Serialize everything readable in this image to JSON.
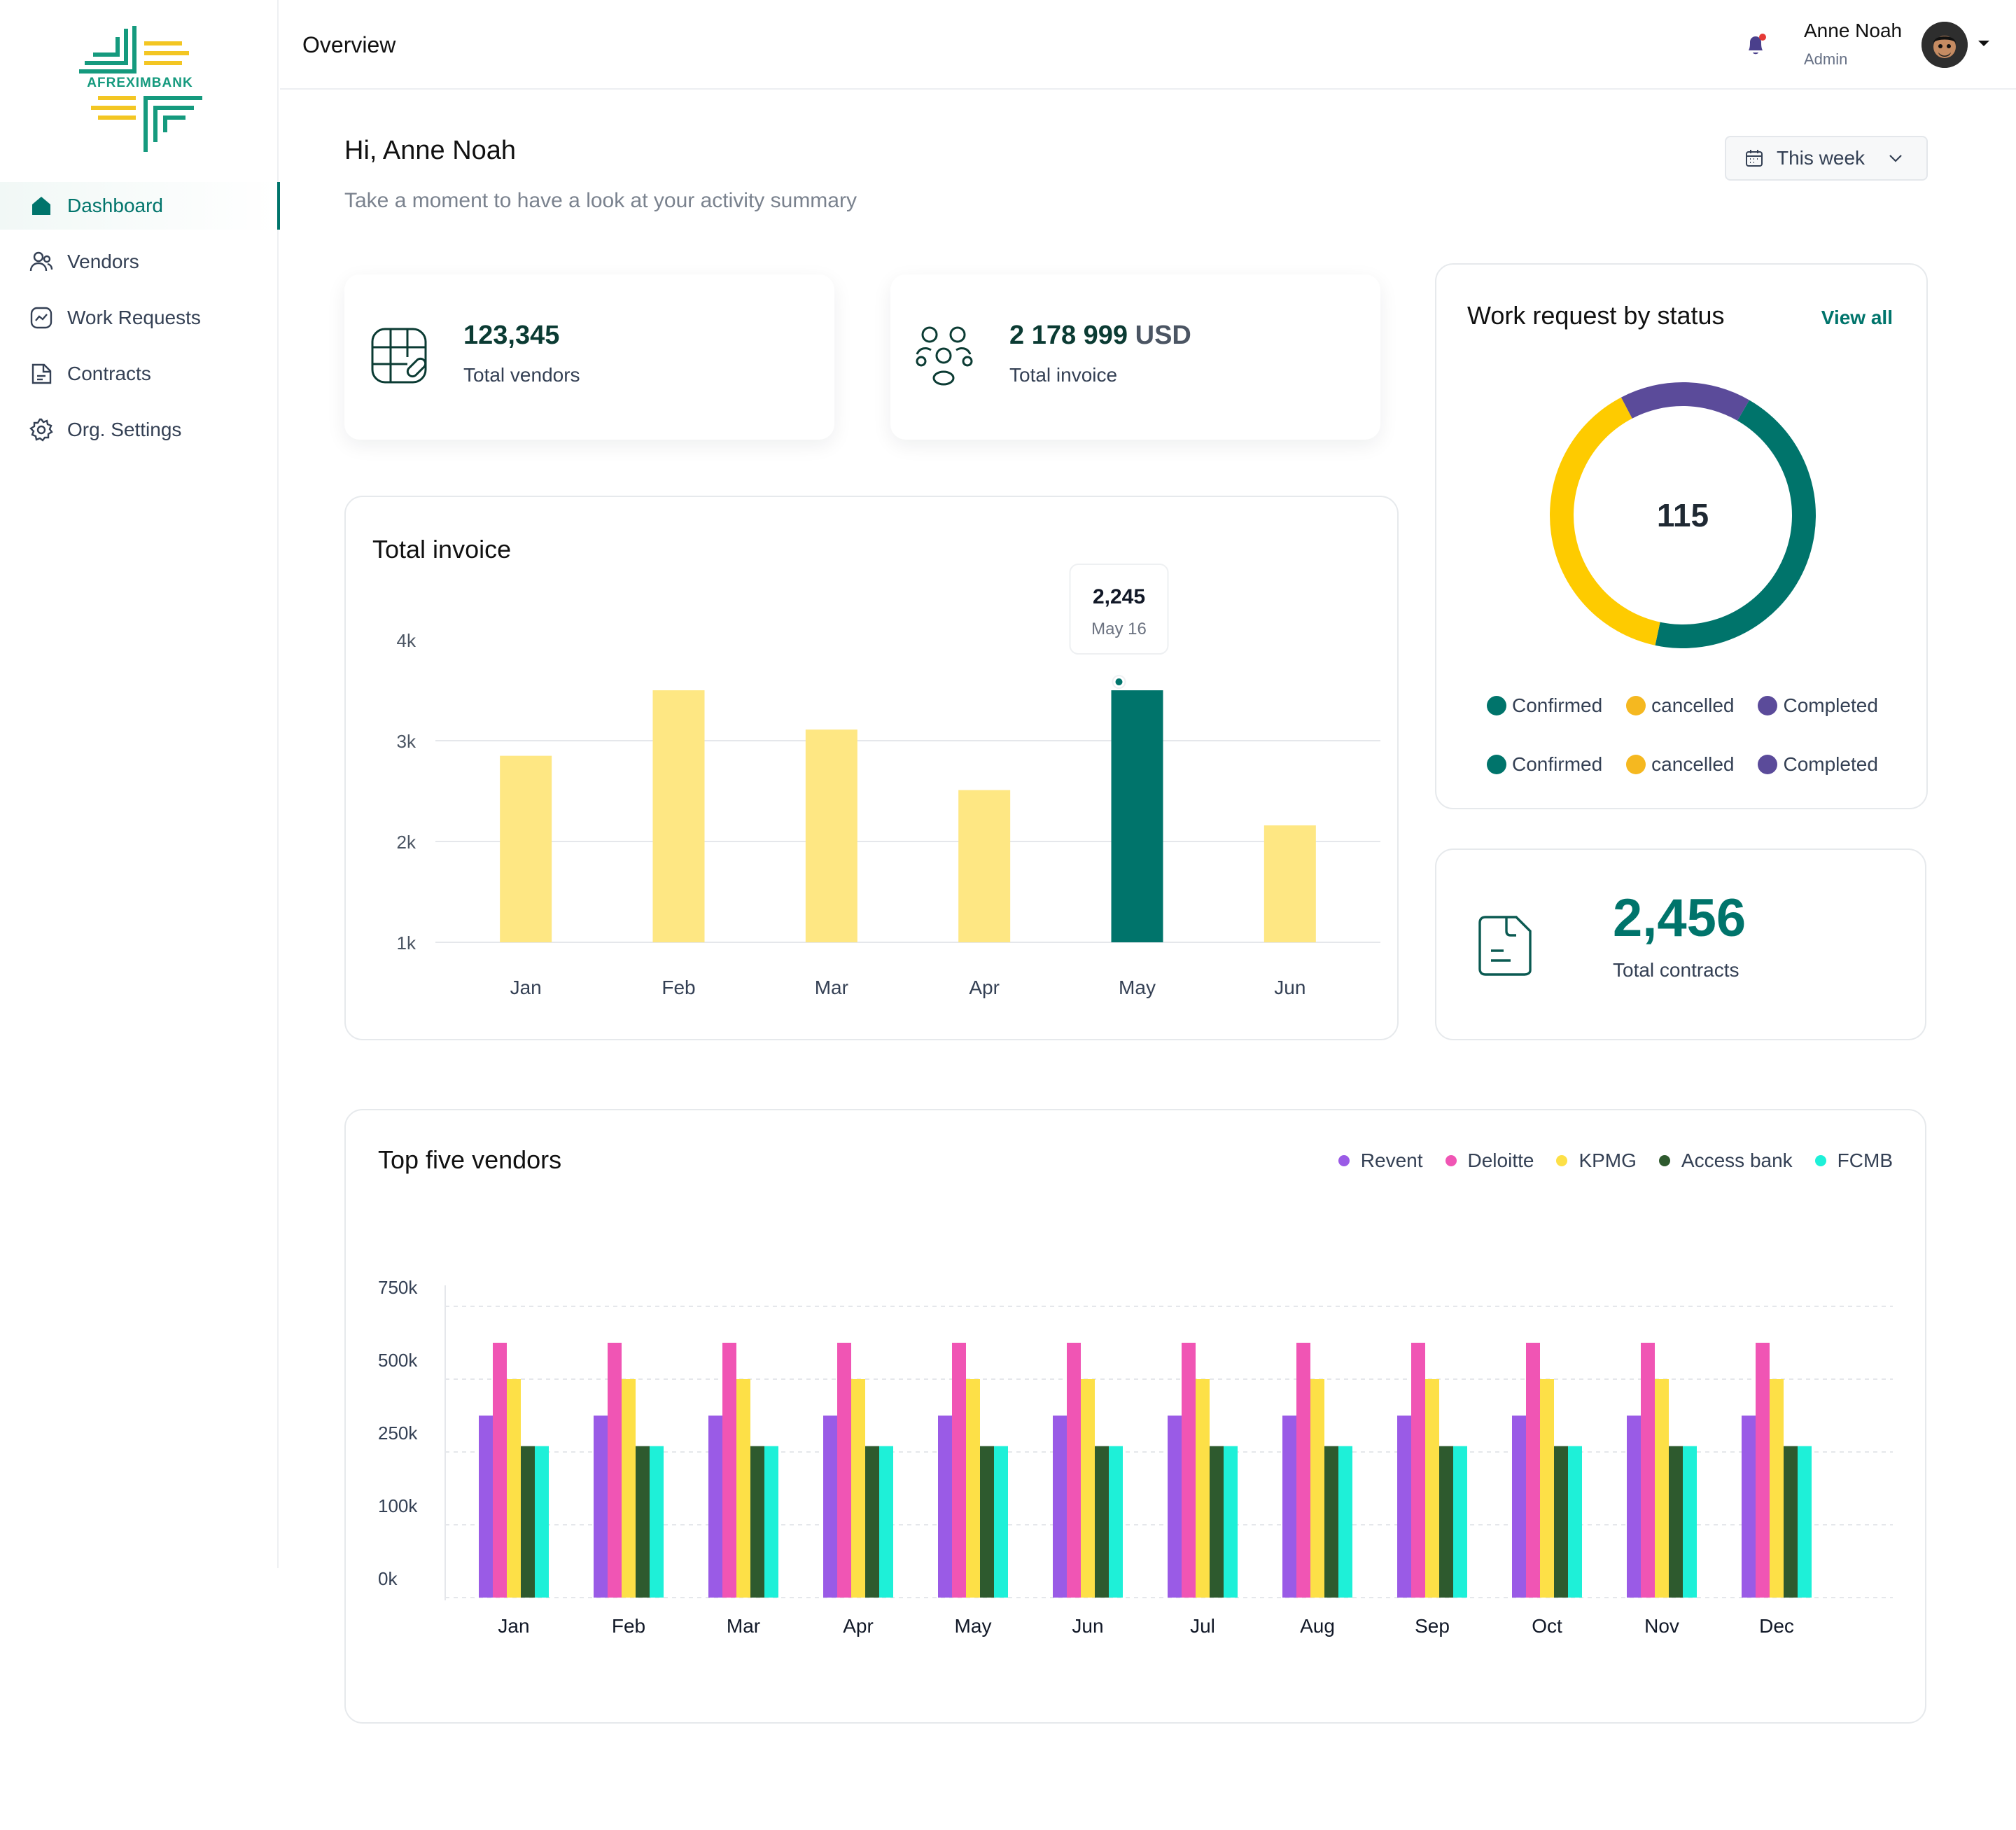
{
  "brand": {
    "name": "AFREXIMBANK"
  },
  "sidebar": {
    "items": [
      {
        "label": "Dashboard",
        "icon": "home-icon",
        "active": true
      },
      {
        "label": "Vendors",
        "icon": "users-icon",
        "active": false
      },
      {
        "label": "Work Requests",
        "icon": "trend-icon",
        "active": false
      },
      {
        "label": "Contracts",
        "icon": "document-icon",
        "active": false
      },
      {
        "label": "Org. Settings",
        "icon": "gear-icon",
        "active": false
      }
    ]
  },
  "header": {
    "title": "Overview",
    "user": {
      "name": "Anne Noah",
      "role": "Admin"
    }
  },
  "greeting": {
    "title": "Hi, Anne Noah",
    "subtitle": "Take a moment to have a look at your activity summary"
  },
  "period_filter": {
    "label": "This week"
  },
  "stats": {
    "vendors": {
      "value": "123,345",
      "label": "Total vendors"
    },
    "invoice": {
      "value": "2 178 999",
      "unit": "USD",
      "label": "Total invoice"
    }
  },
  "work_requests": {
    "title": "Work request by status",
    "view_all": "View all",
    "total": "115",
    "legend_rows": [
      [
        {
          "label": "Confirmed",
          "color": "#00746b"
        },
        {
          "label": "cancelled",
          "color": "#f5b820"
        },
        {
          "label": "Completed",
          "color": "#5b4b9a"
        }
      ],
      [
        {
          "label": "Confirmed",
          "color": "#00746b"
        },
        {
          "label": "cancelled",
          "color": "#f5b820"
        },
        {
          "label": "Completed",
          "color": "#5b4b9a"
        }
      ]
    ]
  },
  "contracts": {
    "value": "2,456",
    "label": "Total contracts"
  },
  "colors": {
    "primary": "#00746b",
    "invoice_bar": "#fee783",
    "invoice_bar_highlight": "#00746b"
  },
  "chart_data": [
    {
      "type": "bar",
      "title": "Total invoice",
      "categories": [
        "Jan",
        "Feb",
        "Mar",
        "Apr",
        "May",
        "Jun"
      ],
      "values": [
        2850,
        3500,
        3110,
        2510,
        3500,
        2160
      ],
      "ylim": [
        1000,
        4000
      ],
      "yticks": [
        "1k",
        "2k",
        "3k",
        "4k"
      ],
      "highlight_index": 4,
      "tooltip": {
        "value": "2,245",
        "label": "May 16"
      },
      "grid": true
    },
    {
      "type": "bar",
      "title": "Top five vendors",
      "categories": [
        "Jan",
        "Feb",
        "Mar",
        "Apr",
        "May",
        "Jun",
        "Jul",
        "Aug",
        "Sep",
        "Oct",
        "Nov",
        "Dec"
      ],
      "yticks": [
        "0k",
        "100k",
        "250k",
        "500k",
        "750k"
      ],
      "legend_position": "top-right",
      "grid": true,
      "series": [
        {
          "name": "Revent",
          "color": "#9a5be6",
          "values": [
            375000,
            375000,
            375000,
            375000,
            375000,
            375000,
            375000,
            375000,
            375000,
            375000,
            375000,
            375000
          ]
        },
        {
          "name": "Deloitte",
          "color": "#f055b4",
          "values": [
            625000,
            625000,
            625000,
            625000,
            625000,
            625000,
            625000,
            625000,
            625000,
            625000,
            625000,
            625000
          ]
        },
        {
          "name": "KPMG",
          "color": "#fde047",
          "values": [
            500000,
            500000,
            500000,
            500000,
            500000,
            500000,
            500000,
            500000,
            500000,
            500000,
            500000,
            500000
          ]
        },
        {
          "name": "Access bank",
          "color": "#2e5a2e",
          "values": [
            270000,
            270000,
            270000,
            270000,
            270000,
            270000,
            270000,
            270000,
            270000,
            270000,
            270000,
            270000
          ]
        },
        {
          "name": "FCMB",
          "color": "#1ef0d8",
          "values": [
            270000,
            270000,
            270000,
            270000,
            270000,
            270000,
            270000,
            270000,
            270000,
            270000,
            270000,
            270000
          ]
        }
      ]
    },
    {
      "type": "pie",
      "title": "Work request by status",
      "labels": [
        "Confirmed",
        "cancelled",
        "Completed"
      ],
      "values": [
        45,
        39,
        16
      ],
      "colors": [
        "#00746b",
        "#fecb00",
        "#5b4b9a"
      ]
    }
  ]
}
